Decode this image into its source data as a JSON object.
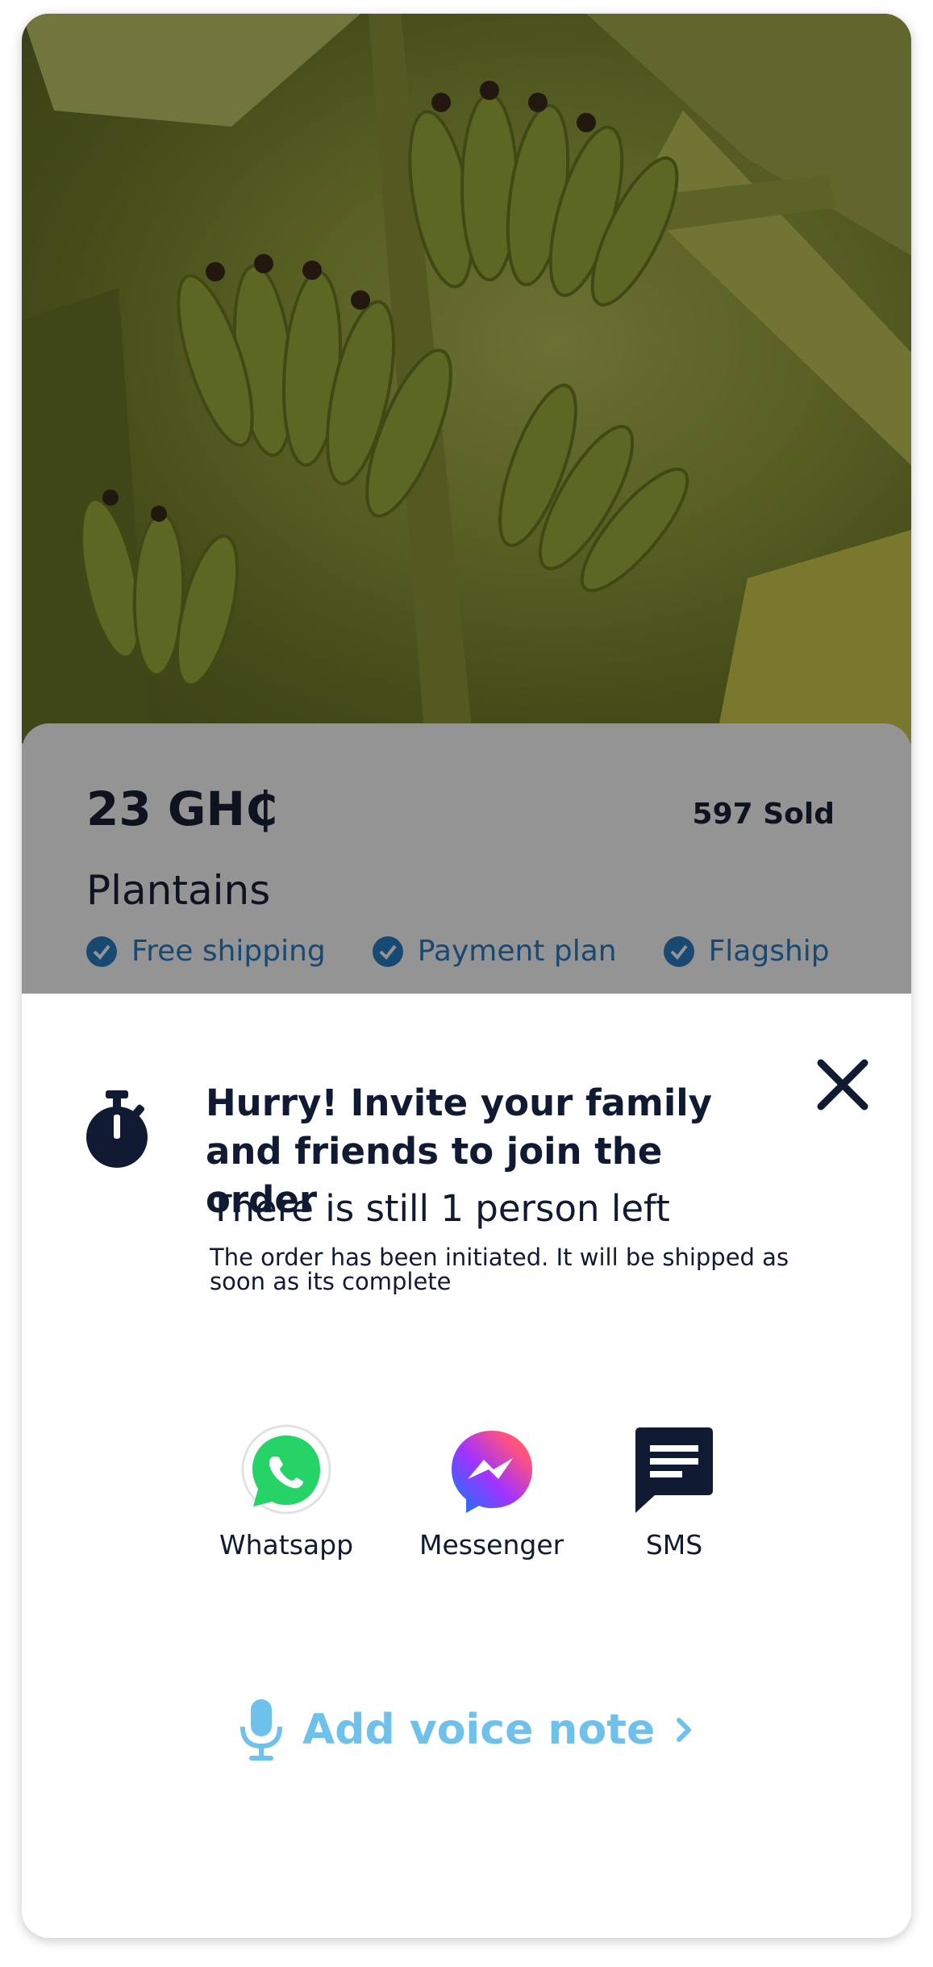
{
  "product": {
    "price": "23 GH₵",
    "sold": "597 Sold",
    "name": "Plantains",
    "features": [
      "Free shipping",
      "Payment plan",
      "Flagship"
    ]
  },
  "invite_sheet": {
    "headline": "Hurry! Invite your family and friends to join the order",
    "remaining": "There is still 1 person left",
    "note": "The order has been initiated. It will be shipped as soon as its complete",
    "share_options": [
      {
        "label": "Whatsapp",
        "icon": "whatsapp-icon"
      },
      {
        "label": "Messenger",
        "icon": "messenger-icon"
      },
      {
        "label": "SMS",
        "icon": "sms-icon"
      }
    ],
    "voice_note_label": "Add voice note"
  },
  "colors": {
    "text_dark": "#111a33",
    "accent_blue": "#6ec1ea",
    "check_blue": "#2a7fc4",
    "whatsapp_green": "#25d366"
  }
}
